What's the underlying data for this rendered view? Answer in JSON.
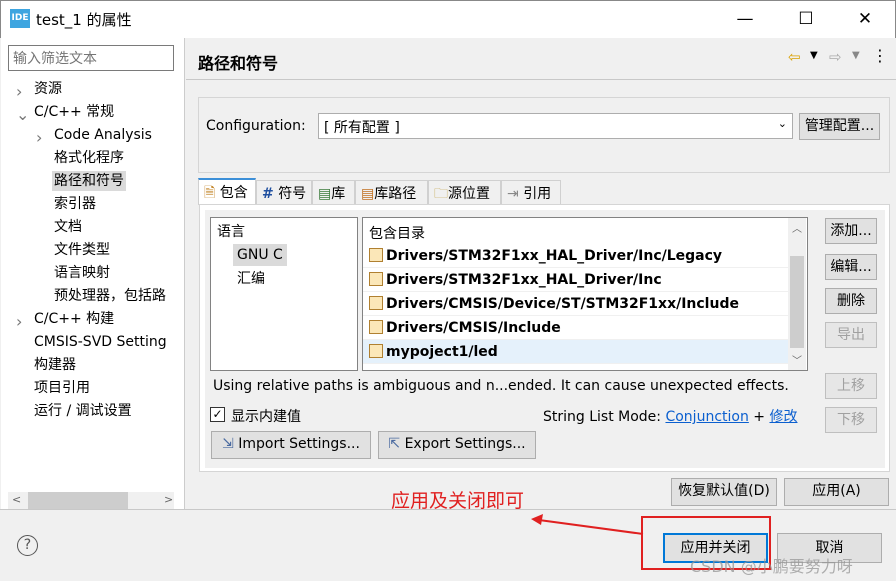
{
  "window": {
    "title": "test_1 的属性",
    "icon_text": "IDE"
  },
  "filter": {
    "placeholder": "输入筛选文本"
  },
  "tree": [
    {
      "label": "资源",
      "chevron": ">"
    },
    {
      "label": "C/C++ 常规",
      "chevron": "v"
    },
    {
      "label": "Code Analysis",
      "chevron": ">"
    },
    {
      "label": "格式化程序"
    },
    {
      "label": "路径和符号",
      "selected": true
    },
    {
      "label": "索引器"
    },
    {
      "label": "文档"
    },
    {
      "label": "文件类型"
    },
    {
      "label": "语言映射"
    },
    {
      "label": "预处理器，包括路"
    },
    {
      "label": "C/C++ 构建",
      "chevron": ">"
    },
    {
      "label": "CMSIS-SVD Setting"
    },
    {
      "label": "构建器"
    },
    {
      "label": "项目引用"
    },
    {
      "label": "运行 / 调试设置"
    }
  ],
  "page": {
    "title": "路径和符号"
  },
  "config": {
    "label": "Configuration:",
    "value": "[ 所有配置 ]",
    "manage_button": "管理配置..."
  },
  "tabs": [
    "包含",
    "符号",
    "库",
    "库路径",
    "源位置",
    "引用"
  ],
  "languages": {
    "header": "语言",
    "items": [
      "GNU C",
      "汇编"
    ]
  },
  "includes": {
    "header": "包含目录",
    "items": [
      "Drivers/STM32F1xx_HAL_Driver/Inc/Legacy",
      "Drivers/STM32F1xx_HAL_Driver/Inc",
      "Drivers/CMSIS/Device/ST/STM32F1xx/Include",
      "Drivers/CMSIS/Include",
      "mypoject1/led"
    ]
  },
  "side_buttons": {
    "add": "添加...",
    "edit": "编辑...",
    "delete": "删除",
    "export": "导出",
    "up": "上移",
    "down": "下移"
  },
  "warning": "Using relative paths is ambiguous and n...ended. It can cause unexpected effects.",
  "show_builtin": {
    "label": "显示内建值",
    "checked": true
  },
  "string_list": {
    "label": "String List Mode:",
    "mode": "Conjunction",
    "plus": "+",
    "modify": "修改"
  },
  "import_button": "Import Settings...",
  "export_button": "Export Settings...",
  "restore_button": "恢复默认值(D)",
  "apply_button": "应用(A)",
  "apply_close_button": "应用并关闭",
  "cancel_button": "取消",
  "annotation": "应用及关闭即可",
  "watermark": "CSDN @小鹏要努力呀",
  "colors": {
    "accent": "#0078d7",
    "annotation": "#e02020",
    "link": "#0b5fcf"
  }
}
